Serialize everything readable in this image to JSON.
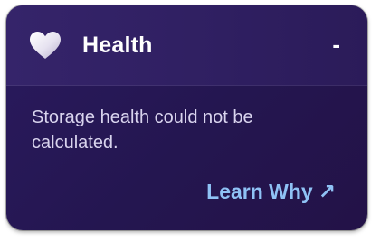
{
  "widget": {
    "icon": "heart-icon",
    "title": "Health",
    "status_value": "-",
    "message": "Storage health could not be calculated.",
    "link_label": "Learn Why",
    "link_icon": "↗",
    "colors": {
      "background": "#241650",
      "header": "#33236a",
      "link": "#8fc2f5",
      "text": "#d9d4ee"
    }
  }
}
